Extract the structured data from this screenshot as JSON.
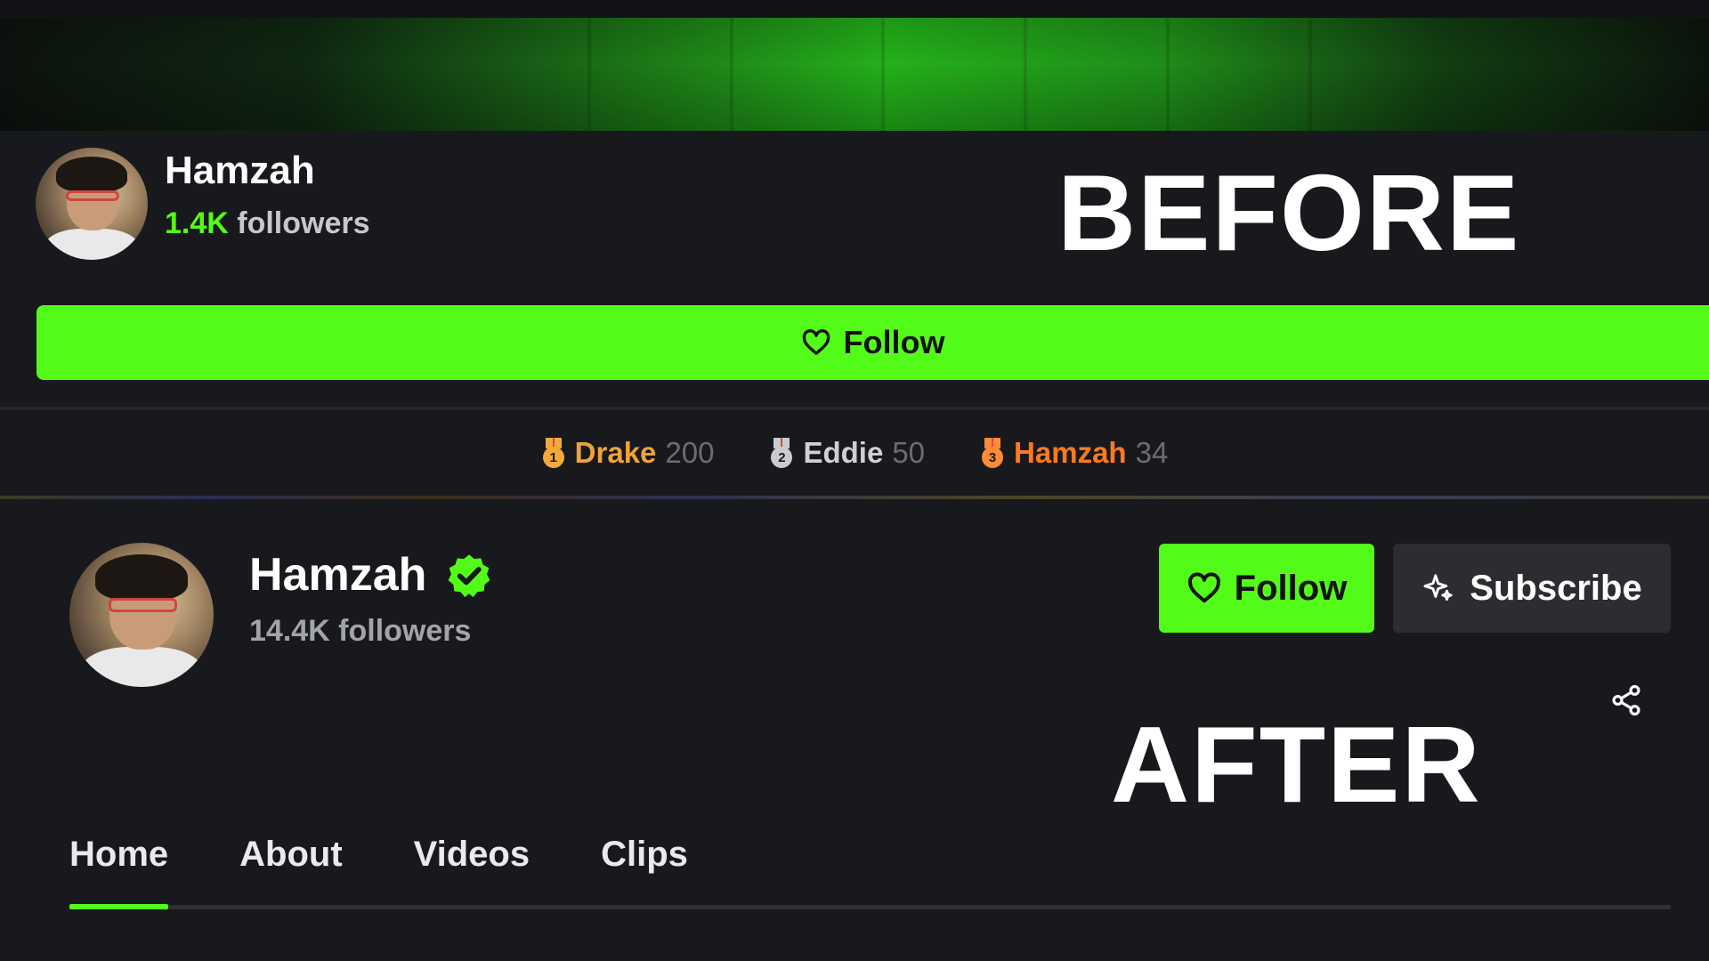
{
  "before": {
    "label": "BEFORE",
    "channel": {
      "name": "Hamzah",
      "followers_count": "1.4K",
      "followers_suffix": " followers"
    },
    "follow_button_label": "Follow",
    "leaderboard": [
      {
        "rank": "1",
        "name": "Drake",
        "score": "200",
        "name_color": "#f0a33a",
        "medal_color": "#f2a93b"
      },
      {
        "rank": "2",
        "name": "Eddie",
        "score": "50",
        "name_color": "#cfd0d4",
        "medal_color": "#c9cbd0"
      },
      {
        "rank": "3",
        "name": "Hamzah",
        "score": "34",
        "name_color": "#ff7a1f",
        "medal_color": "#ff8a3a"
      }
    ]
  },
  "after": {
    "label": "AFTER",
    "channel": {
      "name": "Hamzah",
      "followers": "14.4K followers"
    },
    "follow_button_label": "Follow",
    "subscribe_button_label": "Subscribe",
    "tabs": [
      {
        "label": "Home",
        "active": true
      },
      {
        "label": "About",
        "active": false
      },
      {
        "label": "Videos",
        "active": false
      },
      {
        "label": "Clips",
        "active": false
      }
    ]
  },
  "colors": {
    "accent": "#53fc18",
    "background": "#18191d",
    "secondary_button": "#2b2d31"
  },
  "icons": {
    "follow": "heart-outline-icon",
    "subscribe": "sparkle-icon",
    "share": "share-icon",
    "verified": "verified-badge-icon"
  }
}
